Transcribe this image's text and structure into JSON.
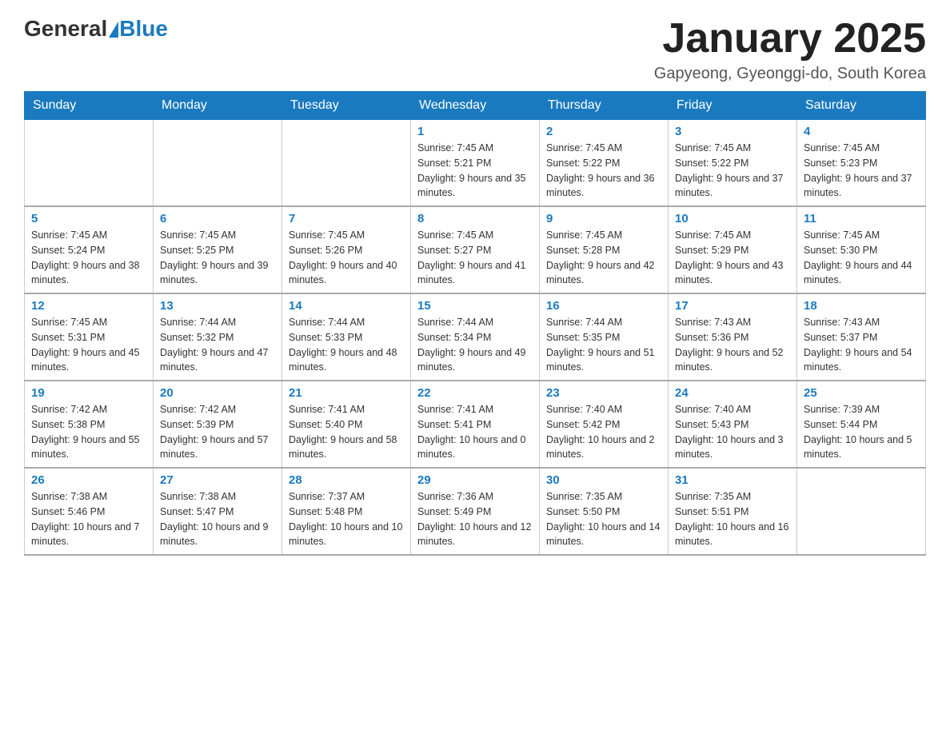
{
  "logo": {
    "general": "General",
    "blue": "Blue"
  },
  "title": "January 2025",
  "subtitle": "Gapyeong, Gyeonggi-do, South Korea",
  "days_of_week": [
    "Sunday",
    "Monday",
    "Tuesday",
    "Wednesday",
    "Thursday",
    "Friday",
    "Saturday"
  ],
  "weeks": [
    [
      {
        "day": "",
        "info": ""
      },
      {
        "day": "",
        "info": ""
      },
      {
        "day": "",
        "info": ""
      },
      {
        "day": "1",
        "info": "Sunrise: 7:45 AM\nSunset: 5:21 PM\nDaylight: 9 hours and 35 minutes."
      },
      {
        "day": "2",
        "info": "Sunrise: 7:45 AM\nSunset: 5:22 PM\nDaylight: 9 hours and 36 minutes."
      },
      {
        "day": "3",
        "info": "Sunrise: 7:45 AM\nSunset: 5:22 PM\nDaylight: 9 hours and 37 minutes."
      },
      {
        "day": "4",
        "info": "Sunrise: 7:45 AM\nSunset: 5:23 PM\nDaylight: 9 hours and 37 minutes."
      }
    ],
    [
      {
        "day": "5",
        "info": "Sunrise: 7:45 AM\nSunset: 5:24 PM\nDaylight: 9 hours and 38 minutes."
      },
      {
        "day": "6",
        "info": "Sunrise: 7:45 AM\nSunset: 5:25 PM\nDaylight: 9 hours and 39 minutes."
      },
      {
        "day": "7",
        "info": "Sunrise: 7:45 AM\nSunset: 5:26 PM\nDaylight: 9 hours and 40 minutes."
      },
      {
        "day": "8",
        "info": "Sunrise: 7:45 AM\nSunset: 5:27 PM\nDaylight: 9 hours and 41 minutes."
      },
      {
        "day": "9",
        "info": "Sunrise: 7:45 AM\nSunset: 5:28 PM\nDaylight: 9 hours and 42 minutes."
      },
      {
        "day": "10",
        "info": "Sunrise: 7:45 AM\nSunset: 5:29 PM\nDaylight: 9 hours and 43 minutes."
      },
      {
        "day": "11",
        "info": "Sunrise: 7:45 AM\nSunset: 5:30 PM\nDaylight: 9 hours and 44 minutes."
      }
    ],
    [
      {
        "day": "12",
        "info": "Sunrise: 7:45 AM\nSunset: 5:31 PM\nDaylight: 9 hours and 45 minutes."
      },
      {
        "day": "13",
        "info": "Sunrise: 7:44 AM\nSunset: 5:32 PM\nDaylight: 9 hours and 47 minutes."
      },
      {
        "day": "14",
        "info": "Sunrise: 7:44 AM\nSunset: 5:33 PM\nDaylight: 9 hours and 48 minutes."
      },
      {
        "day": "15",
        "info": "Sunrise: 7:44 AM\nSunset: 5:34 PM\nDaylight: 9 hours and 49 minutes."
      },
      {
        "day": "16",
        "info": "Sunrise: 7:44 AM\nSunset: 5:35 PM\nDaylight: 9 hours and 51 minutes."
      },
      {
        "day": "17",
        "info": "Sunrise: 7:43 AM\nSunset: 5:36 PM\nDaylight: 9 hours and 52 minutes."
      },
      {
        "day": "18",
        "info": "Sunrise: 7:43 AM\nSunset: 5:37 PM\nDaylight: 9 hours and 54 minutes."
      }
    ],
    [
      {
        "day": "19",
        "info": "Sunrise: 7:42 AM\nSunset: 5:38 PM\nDaylight: 9 hours and 55 minutes."
      },
      {
        "day": "20",
        "info": "Sunrise: 7:42 AM\nSunset: 5:39 PM\nDaylight: 9 hours and 57 minutes."
      },
      {
        "day": "21",
        "info": "Sunrise: 7:41 AM\nSunset: 5:40 PM\nDaylight: 9 hours and 58 minutes."
      },
      {
        "day": "22",
        "info": "Sunrise: 7:41 AM\nSunset: 5:41 PM\nDaylight: 10 hours and 0 minutes."
      },
      {
        "day": "23",
        "info": "Sunrise: 7:40 AM\nSunset: 5:42 PM\nDaylight: 10 hours and 2 minutes."
      },
      {
        "day": "24",
        "info": "Sunrise: 7:40 AM\nSunset: 5:43 PM\nDaylight: 10 hours and 3 minutes."
      },
      {
        "day": "25",
        "info": "Sunrise: 7:39 AM\nSunset: 5:44 PM\nDaylight: 10 hours and 5 minutes."
      }
    ],
    [
      {
        "day": "26",
        "info": "Sunrise: 7:38 AM\nSunset: 5:46 PM\nDaylight: 10 hours and 7 minutes."
      },
      {
        "day": "27",
        "info": "Sunrise: 7:38 AM\nSunset: 5:47 PM\nDaylight: 10 hours and 9 minutes."
      },
      {
        "day": "28",
        "info": "Sunrise: 7:37 AM\nSunset: 5:48 PM\nDaylight: 10 hours and 10 minutes."
      },
      {
        "day": "29",
        "info": "Sunrise: 7:36 AM\nSunset: 5:49 PM\nDaylight: 10 hours and 12 minutes."
      },
      {
        "day": "30",
        "info": "Sunrise: 7:35 AM\nSunset: 5:50 PM\nDaylight: 10 hours and 14 minutes."
      },
      {
        "day": "31",
        "info": "Sunrise: 7:35 AM\nSunset: 5:51 PM\nDaylight: 10 hours and 16 minutes."
      },
      {
        "day": "",
        "info": ""
      }
    ]
  ]
}
